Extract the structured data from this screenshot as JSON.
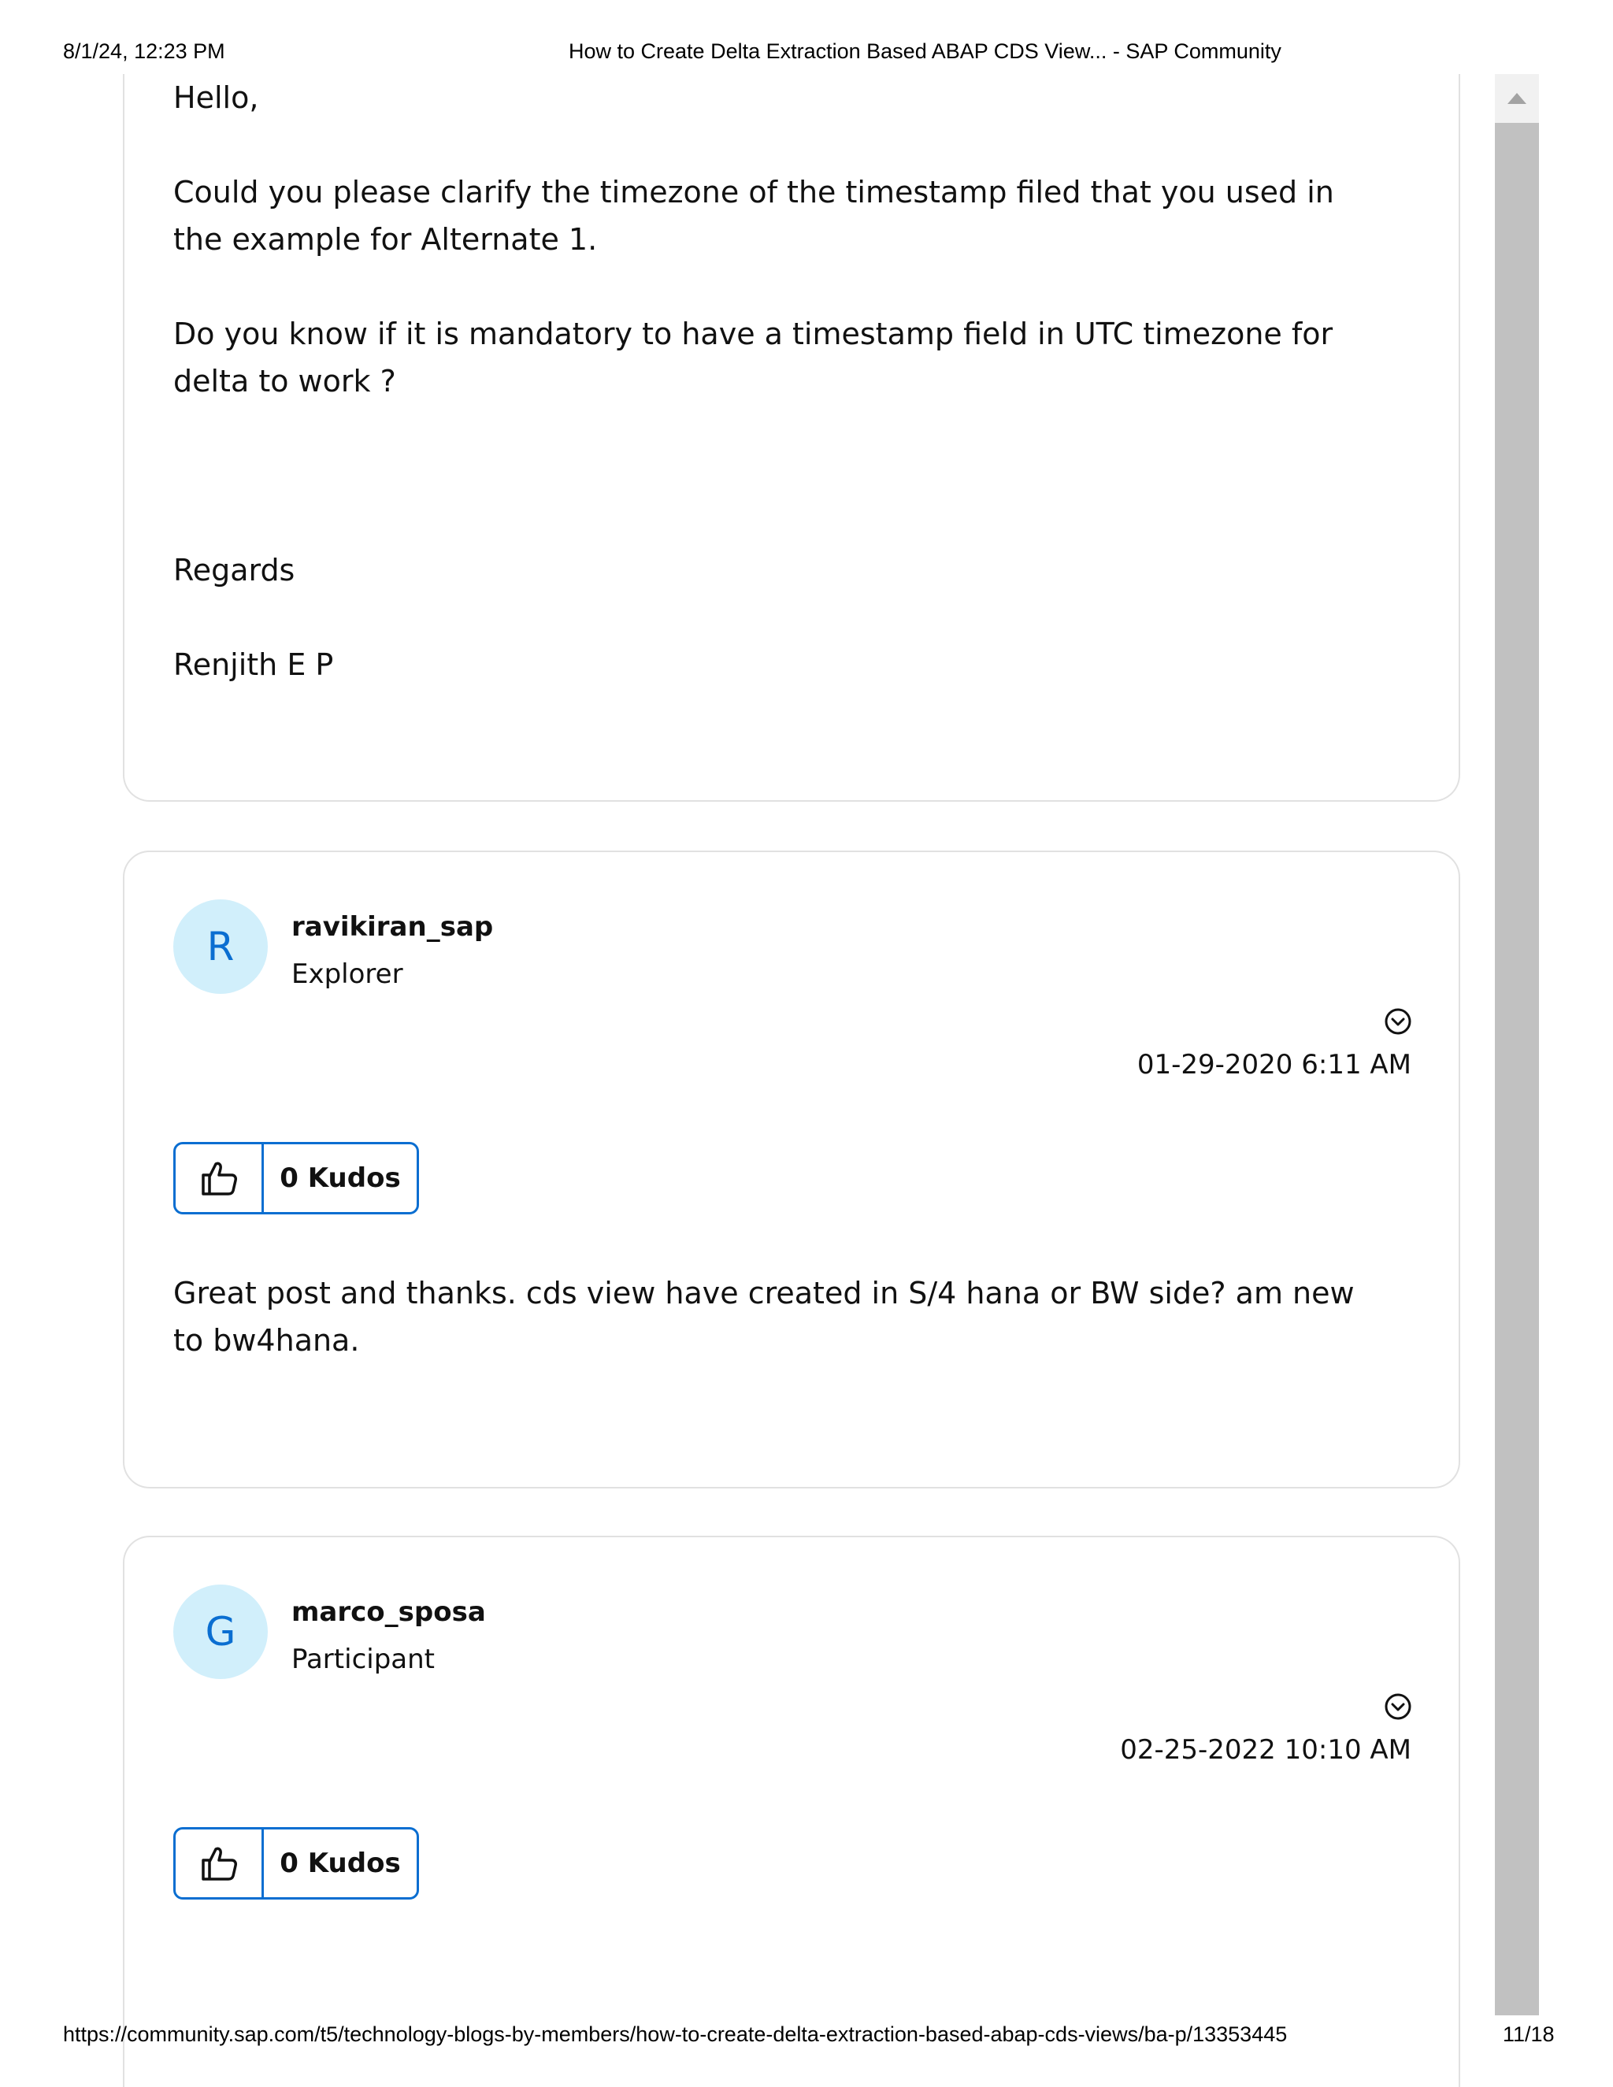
{
  "print_header": {
    "datetime": "8/1/24, 12:23 PM",
    "title": "How to Create Delta Extraction Based ABAP CDS View... - SAP Community"
  },
  "comments": [
    {
      "paragraphs": [
        "Hello,",
        "Could you please clarify the timezone of the timestamp filed that you used in the example for Alternate 1.",
        "Do you know if it is mandatory to have a timestamp field in UTC timezone for delta to work ?",
        "Regards",
        "Renjith E P"
      ]
    },
    {
      "avatar_letter": "R",
      "author": "ravikiran_sap",
      "rank": "Explorer",
      "date": "01-29-2020 6:11 AM",
      "kudos_label": "0 Kudos",
      "body": "Great post and thanks. cds view have created in S/4 hana or BW side? am new to bw4hana."
    },
    {
      "avatar_letter": "G",
      "author": "marco_sposa",
      "rank": "Participant",
      "date": "02-25-2022 10:10 AM",
      "kudos_label": "0 Kudos"
    }
  ],
  "print_footer": {
    "url": "https://community.sap.com/t5/technology-blogs-by-members/how-to-create-delta-extraction-based-abap-cds-views/ba-p/13353445",
    "page": "11/18"
  },
  "colors": {
    "accent": "#0a6ed1",
    "avatar_bg": "#d1effb",
    "card_border": "#e1e1e1",
    "scrollbar_thumb": "#c1c1c1"
  },
  "icons": [
    "thumbs-up-icon",
    "chevron-down-circle-icon",
    "scroll-up-arrow-icon"
  ]
}
